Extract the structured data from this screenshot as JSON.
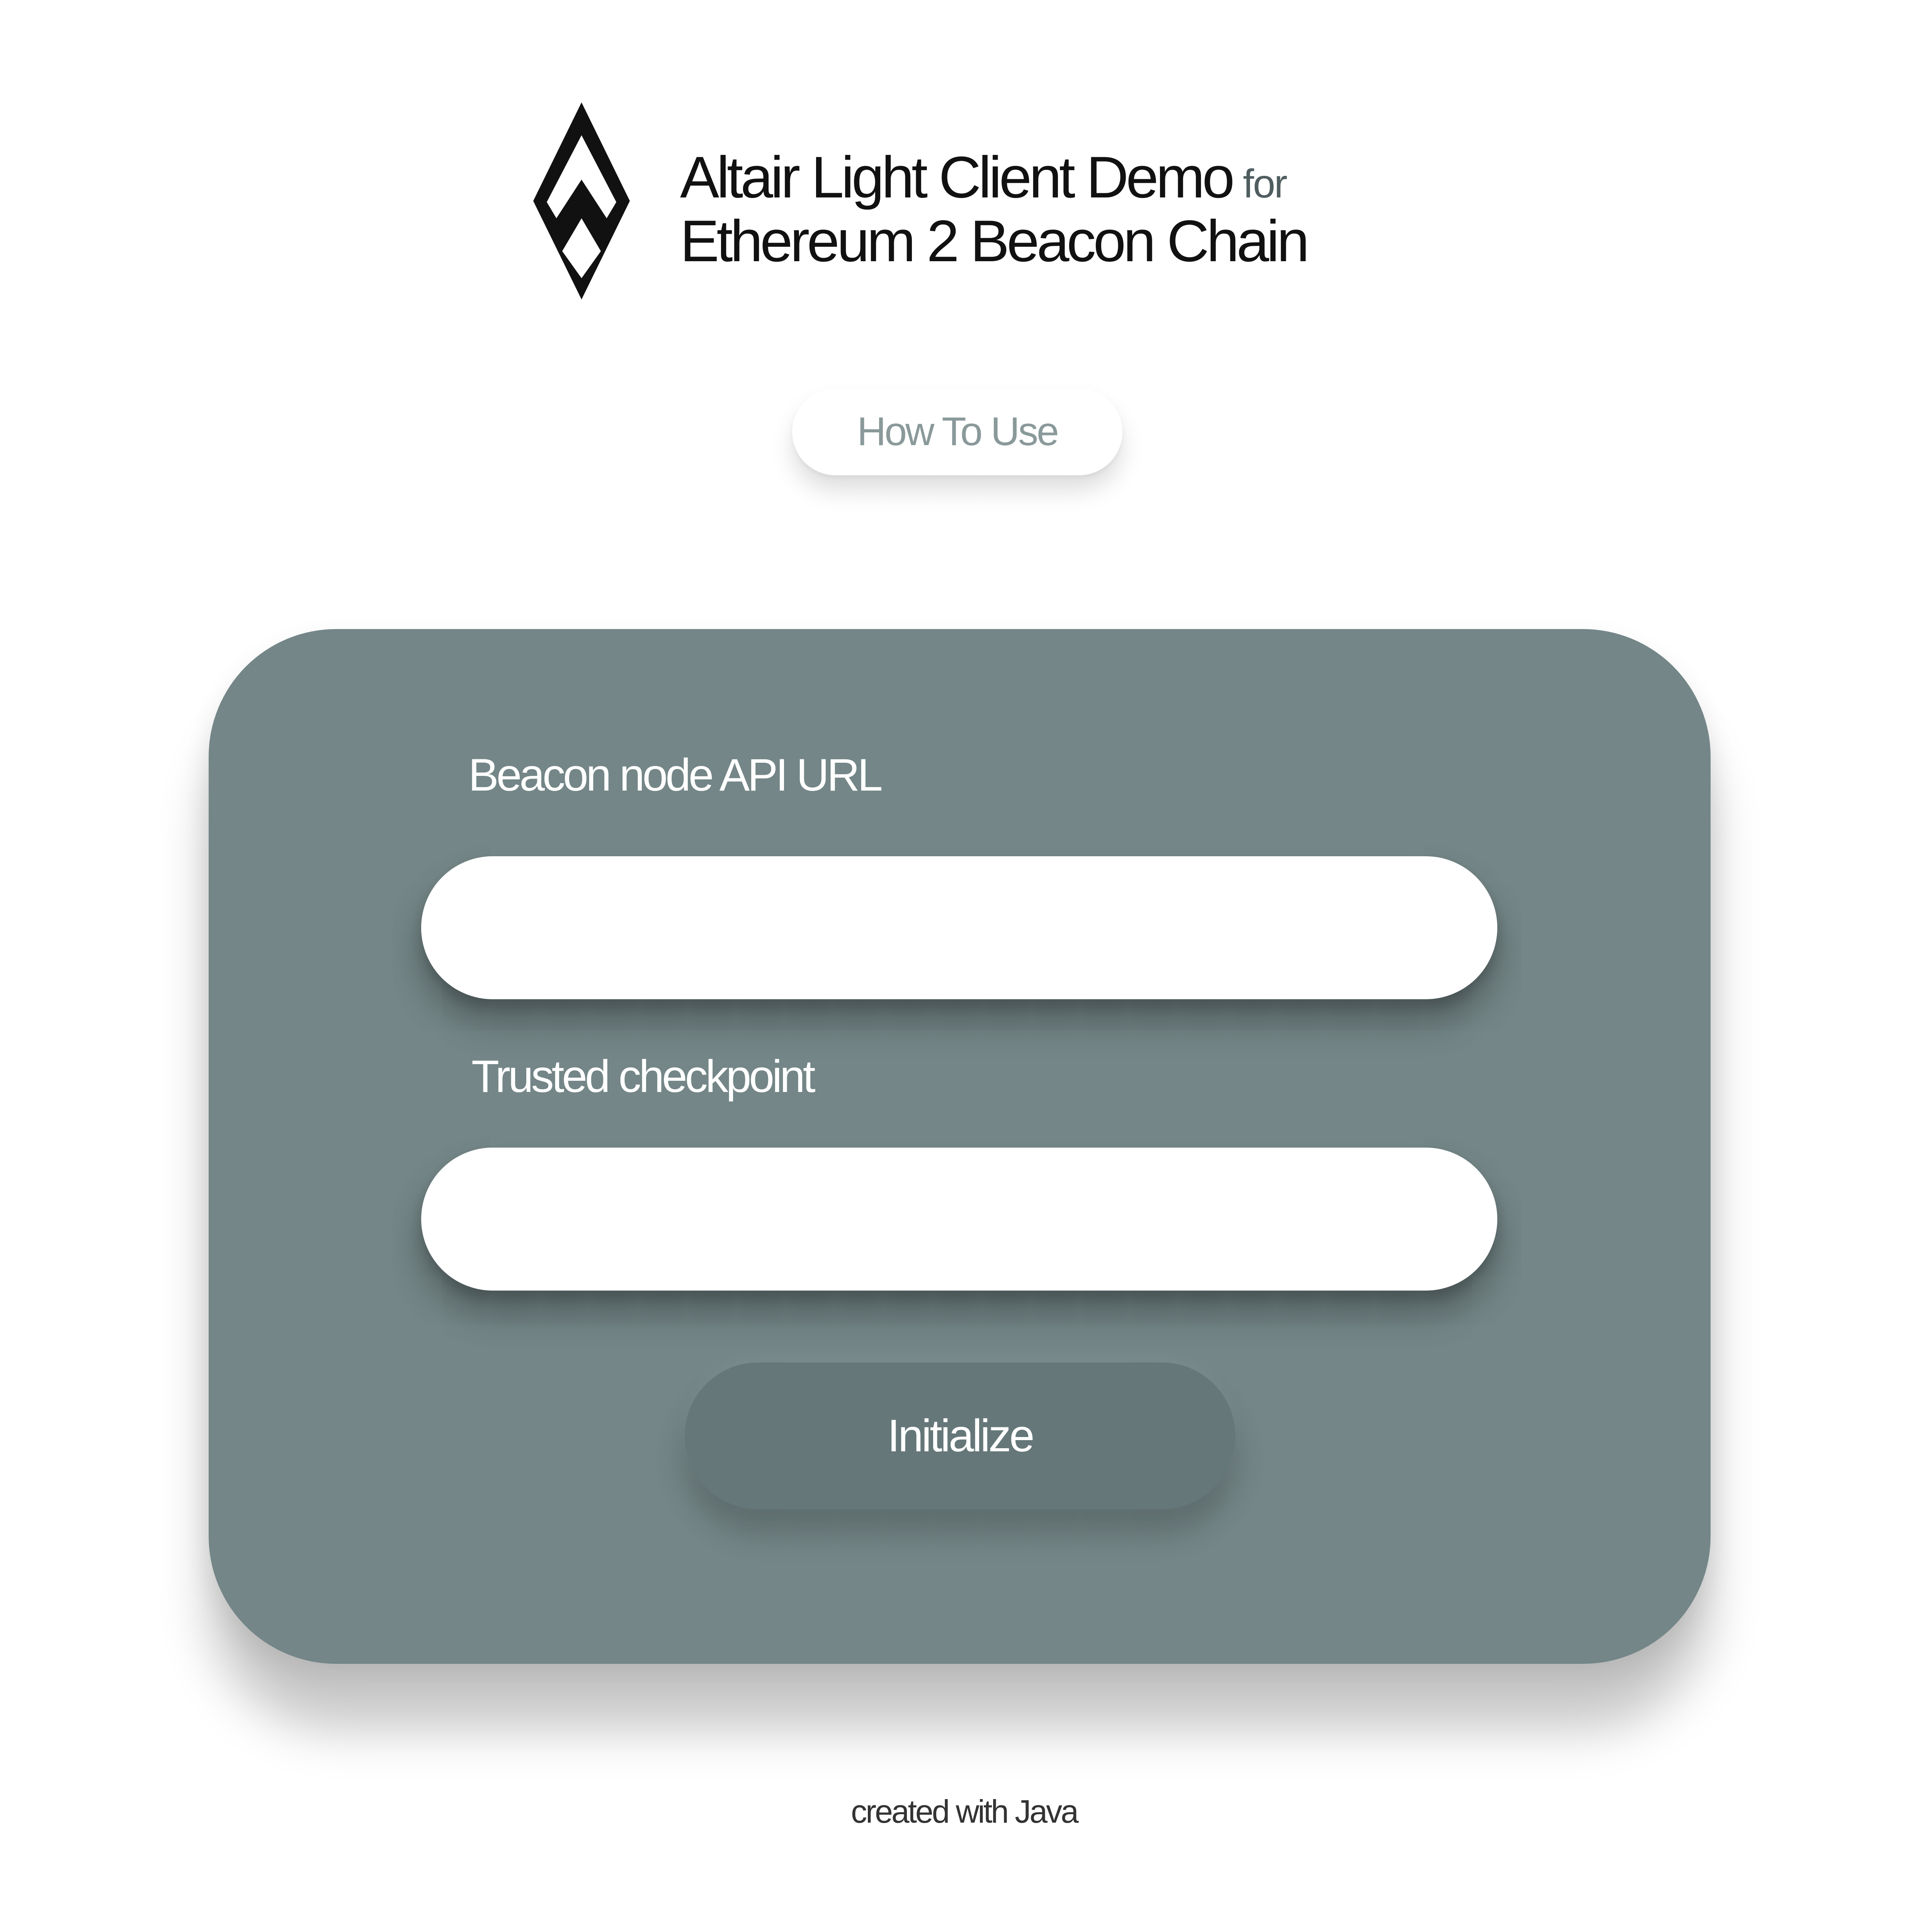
{
  "header": {
    "title_line1": "Altair Light Client Demo",
    "title_for": "for",
    "title_line2": "Ethereum 2 Beacon Chain",
    "logo_icon": "altair-diamond-logo-icon"
  },
  "how_to_use": {
    "label": "How To Use"
  },
  "form": {
    "beacon_url": {
      "label": "Beacon node API URL",
      "value": "",
      "placeholder": ""
    },
    "checkpoint": {
      "label": "Trusted checkpoint",
      "value": "",
      "placeholder": ""
    },
    "initialize_label": "Initialize"
  },
  "footer": {
    "text": "created with Java"
  },
  "colors": {
    "card": "#748687",
    "button": "#657779",
    "accent_text": "#8a999a",
    "background": "#ffffff"
  }
}
